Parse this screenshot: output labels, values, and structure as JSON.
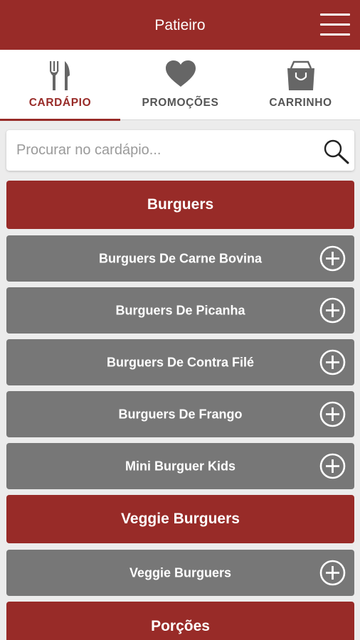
{
  "header": {
    "title": "Patieiro",
    "menu_icon": "hamburger-icon"
  },
  "tabs": [
    {
      "label": "CARDÁPIO",
      "icon": "fork-knife-icon",
      "active": true
    },
    {
      "label": "PROMOÇÕES",
      "icon": "heart-icon",
      "active": false
    },
    {
      "label": "CARRINHO",
      "icon": "shopping-bag-icon",
      "active": false
    }
  ],
  "search": {
    "placeholder": "Procurar no cardápio...",
    "value": ""
  },
  "menu": {
    "sections": [
      {
        "title": "Burguers"
      },
      {
        "title": "Veggie Burguers"
      },
      {
        "title": "Porções"
      }
    ],
    "items": [
      {
        "label": "Burguers De Carne Bovina"
      },
      {
        "label": "Burguers De Picanha"
      },
      {
        "label": "Burguers De Contra Filé"
      },
      {
        "label": "Burguers De Frango"
      },
      {
        "label": "Mini Burguer Kids"
      },
      {
        "label": "Veggie Burguers"
      }
    ]
  },
  "colors": {
    "brand": "#982b28",
    "item_bg": "#777777",
    "page_bg": "#ececec"
  }
}
